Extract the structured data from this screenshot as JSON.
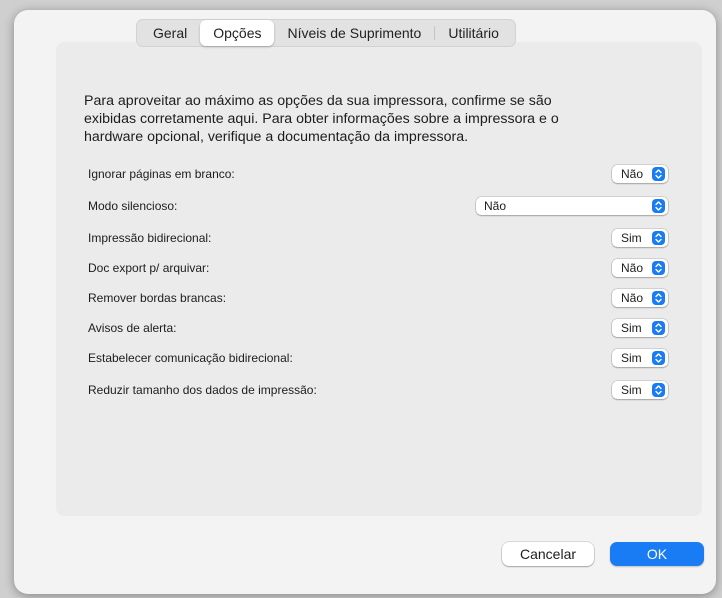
{
  "tabs": [
    {
      "label": "Geral",
      "active": false
    },
    {
      "label": "Opções",
      "active": true
    },
    {
      "label": "Níveis de Suprimento",
      "active": false
    },
    {
      "label": "Utilitário",
      "active": false
    }
  ],
  "description": {
    "line1": "Para aproveitar ao máximo as opções da sua impressora, confirme se são",
    "line2": "exibidas corretamente aqui. Para obter informações sobre a impressora e o",
    "line3": "hardware opcional, verifique a documentação da impressora."
  },
  "options": [
    {
      "label": "Ignorar páginas em branco:",
      "value": "Não"
    },
    {
      "label": "Modo silencioso:",
      "value": "Não"
    },
    {
      "label": "Impressão bidirecional:",
      "value": "Sim"
    },
    {
      "label": "Doc export p/ arquivar:",
      "value": "Não"
    },
    {
      "label": "Remover bordas brancas:",
      "value": "Não"
    },
    {
      "label": "Avisos de alerta:",
      "value": "Sim"
    },
    {
      "label": "Estabelecer comunicação bidirecional:",
      "value": "Sim"
    },
    {
      "label": "Reduzir tamanho dos dados de impressão:",
      "value": "Sim"
    }
  ],
  "buttons": {
    "cancel": "Cancelar",
    "ok": "OK"
  },
  "colors": {
    "accent": "#1a7cf5",
    "dialog_bg": "#f3f3f3",
    "panel_bg": "#ebebeb"
  }
}
